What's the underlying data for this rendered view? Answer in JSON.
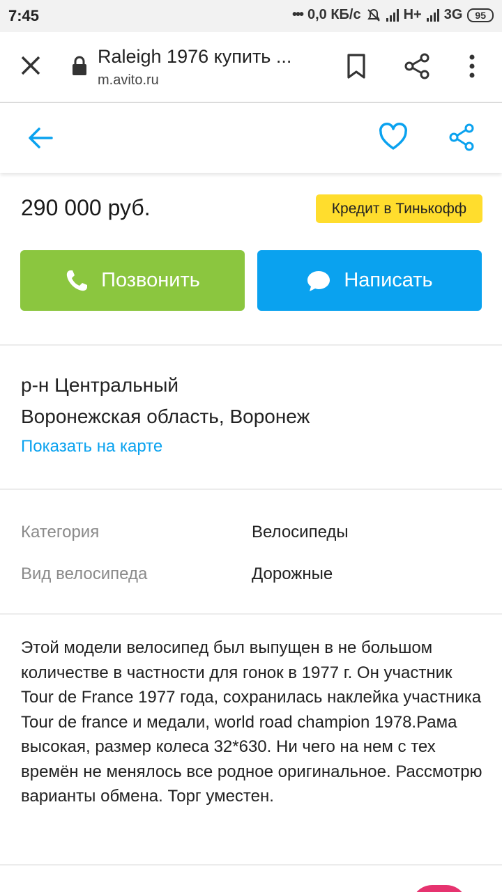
{
  "status_bar": {
    "time": "7:45",
    "net_speed": "0,0 КБ/с",
    "network1": "H+",
    "network2": "3G",
    "battery": "95"
  },
  "browser": {
    "title": "Raleigh 1976 купить ...",
    "url": "m.avito.ru"
  },
  "listing": {
    "price": "290 000 руб.",
    "credit_badge": "Кредит в Тинькофф",
    "call_label": "Позвонить",
    "write_label": "Написать",
    "district": "р-н Центральный",
    "region": "Воронежская область, Воронеж",
    "map_link": "Показать на карте",
    "params": [
      {
        "label": "Категория",
        "value": "Велосипеды"
      },
      {
        "label": "Вид велосипеда",
        "value": "Дорожные"
      }
    ],
    "description": "Этой модели велосипед был выпущен в не большом количестве в частности для гонок в 1977 г. Он участник Tour de France 1977 года, сохранилась наклейка участника Tour de france и медали, world road champion 1978.Рама высокая, размер колеса 32*630. Ни чего на нем с тех времён не менялось все родное оригинальное. Рассмотрю варианты обмена. Торг уместен."
  },
  "colors": {
    "call_button": "#8bc63f",
    "write_button": "#0aa2ef",
    "credit_badge": "#ffdd2d",
    "accent": "#0aa2ef"
  },
  "icons": [
    "close-icon",
    "lock-icon",
    "bookmark-icon",
    "share-icon",
    "more-icon",
    "back-arrow-icon",
    "heart-icon",
    "phone-icon",
    "chat-bubble-icon"
  ]
}
